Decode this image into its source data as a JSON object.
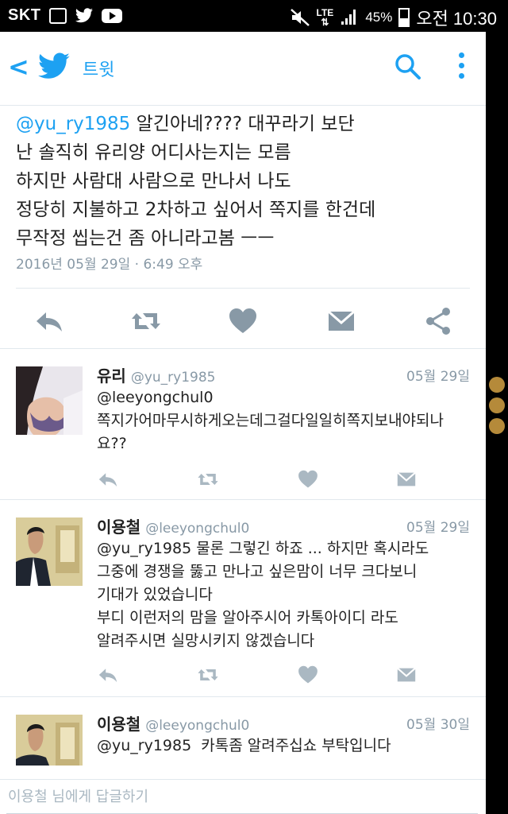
{
  "statusbar": {
    "carrier": "SKT",
    "network": "LTE",
    "battery": "45%",
    "time": "오전 10:30"
  },
  "topbar": {
    "title": "트윗"
  },
  "main_tweet": {
    "mention": "@yu_ry1985",
    "text": " 알긴아네???? 대꾸라기 보단\n난 솔직히 유리양 어디사는지는 모름\n하지만 사람대 사람으로 만나서 나도\n정당히 지불하고 2차하고 싶어서 쪽지를 한건데\n무작정 씹는건 좀 아니라고봄 ㅡㅡ",
    "timestamp": "2016년 05월 29일 · 6:49 오후"
  },
  "replies": [
    {
      "name": "유리",
      "handle": "@yu_ry1985",
      "date": "05월 29일",
      "text": "@leeyongchul0\n쪽지가어마무시하게오는데그걸다일일히쪽지보내야되나요??"
    },
    {
      "name": "이용철",
      "handle": "@leeyongchul0",
      "date": "05월 29일",
      "text": "@yu_ry1985 물론 그렇긴 하죠 ... 하지만 혹시라도\n그중에 경쟁을 뚫고 만나고 싶은맘이 너무 크다보니\n기대가 있었습니다\n부디 이런저의 맘을 알아주시어 카톡아이디 라도\n알려주시면 실망시키지 않겠습니다"
    },
    {
      "name": "이용철",
      "handle": "@leeyongchul0",
      "date": "05월 30일",
      "text": "@yu_ry1985  카톡좀 알려주십쇼 부탁입니다"
    }
  ],
  "composer": {
    "placeholder": "이용철 님에게 답글하기"
  },
  "colors": {
    "accent": "#1da1f2",
    "muted": "#8899a6"
  }
}
